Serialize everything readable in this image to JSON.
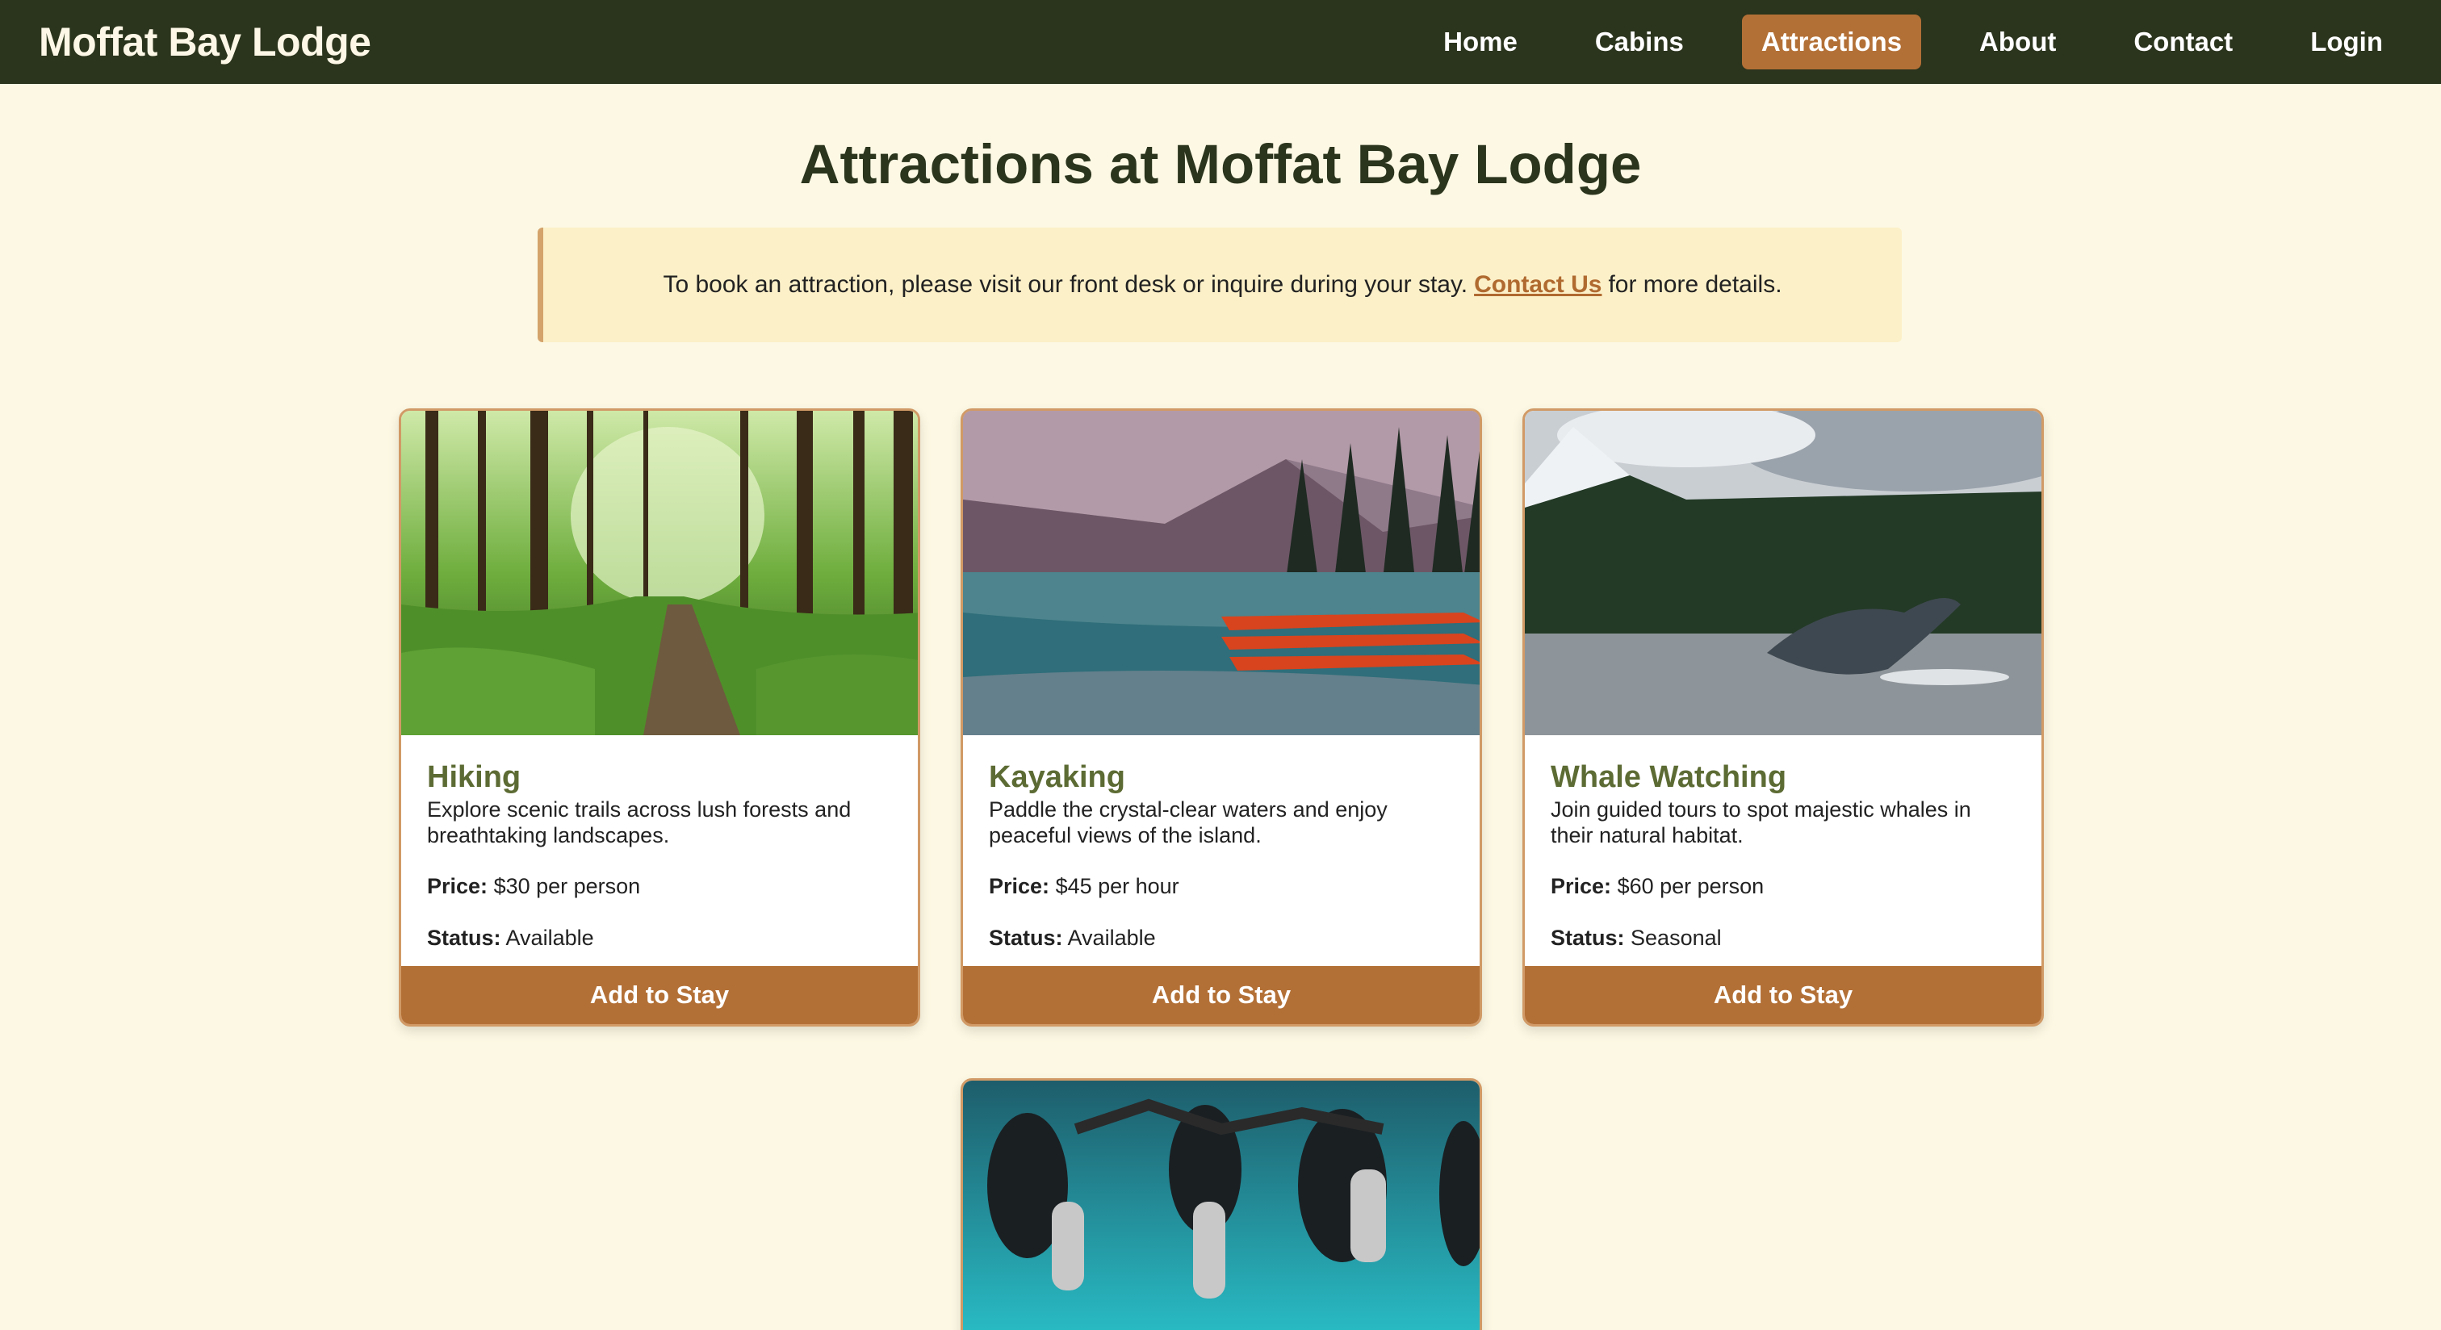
{
  "brand": "Moffat Bay Lodge",
  "nav": [
    {
      "label": "Home",
      "active": false
    },
    {
      "label": "Cabins",
      "active": false
    },
    {
      "label": "Attractions",
      "active": true
    },
    {
      "label": "About",
      "active": false
    },
    {
      "label": "Contact",
      "active": false
    },
    {
      "label": "Login",
      "active": false
    }
  ],
  "page_title": "Attractions at Moffat Bay Lodge",
  "notice": {
    "before": "To book an attraction, please visit our front desk or inquire during your stay.",
    "link": "Contact Us",
    "after": "for more details."
  },
  "price_label": "Price:",
  "status_label": "Status:",
  "button_label": "Add to Stay",
  "attractions": [
    {
      "title": "Hiking",
      "description": "Explore scenic trails across lush forests and breathtaking landscapes.",
      "price": "$30 per person",
      "status": "Available",
      "image": "forest-trail-photo"
    },
    {
      "title": "Kayaking",
      "description": "Paddle the crystal-clear waters and enjoy peaceful views of the island.",
      "price": "$45 per hour",
      "status": "Available",
      "image": "mountain-lake-canoes-photo"
    },
    {
      "title": "Whale Watching",
      "description": "Join guided tours to spot majestic whales in their natural habitat.",
      "price": "$60 per person",
      "status": "Seasonal",
      "image": "humpback-whale-breach-photo"
    },
    {
      "image": "scuba-divers-photo"
    }
  ],
  "colors": {
    "nav_bg": "#2b341d",
    "page_bg": "#fcf8e3",
    "accent": "#b37036",
    "card_title": "#5c6b33",
    "notice_bg": "#fcf0c8"
  }
}
